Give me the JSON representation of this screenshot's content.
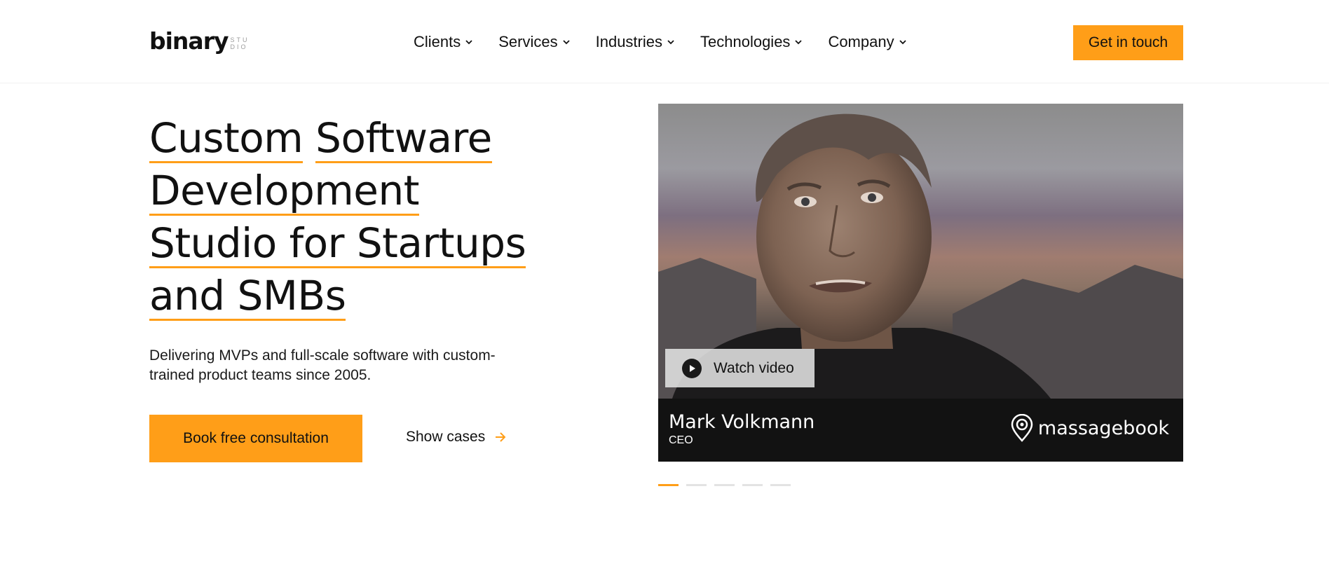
{
  "header": {
    "logo_text": "binary",
    "logo_sub_1": "STU",
    "logo_sub_2": "DIO",
    "nav": [
      "Clients",
      "Services",
      "Industries",
      "Technologies",
      "Company"
    ],
    "cta": "Get in touch"
  },
  "hero": {
    "title_lines": [
      "Custom",
      "Software",
      "Development",
      "Studio for Startups",
      "and SMBs"
    ],
    "subtitle": "Delivering MVPs and full-scale software with custom-trained product teams since 2005.",
    "primary_button": "Book free consultation",
    "secondary_link": "Show cases"
  },
  "testimonial": {
    "watch_label": "Watch video",
    "name": "Mark Volkmann",
    "role": "CEO",
    "company": "massagebook"
  },
  "carousel": {
    "count": 5,
    "active_index": 0
  },
  "colors": {
    "accent": "#ff9e18",
    "text": "#111111",
    "bar": "#121212"
  }
}
